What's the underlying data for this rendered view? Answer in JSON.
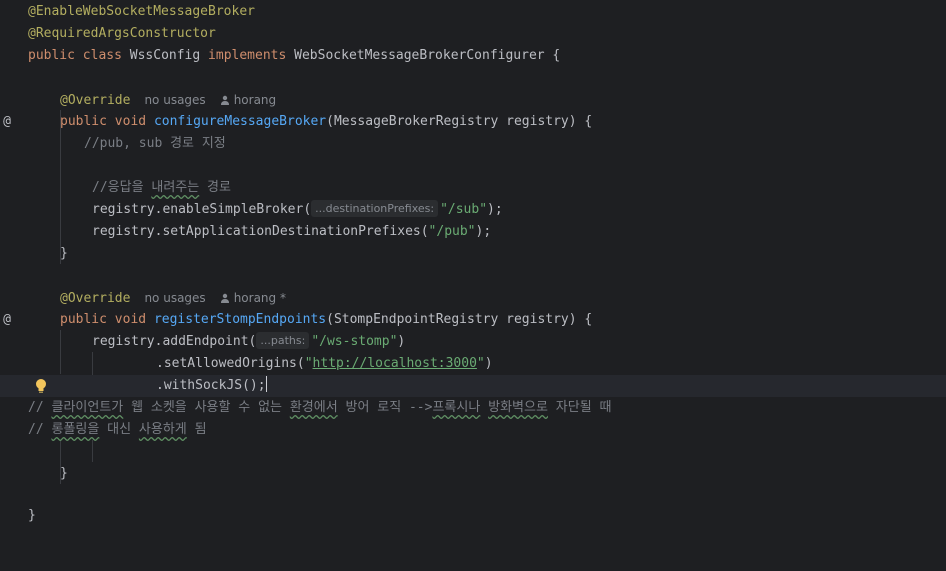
{
  "code": {
    "l1": "@EnableWebSocketMessageBroker",
    "l2": "@RequiredArgsConstructor",
    "l3_kw1": "public",
    "l3_kw2": "class",
    "l3_name": "WssConfig",
    "l3_kw3": "implements",
    "l3_iface": "WebSocketMessageBrokerConfigurer {",
    "m1_annotation": "@Override",
    "m1_usages": "no usages",
    "m1_author": "horang",
    "m1_kw1": "public",
    "m1_kw2": "void",
    "m1_name": "configureMessageBroker",
    "m1_params": "(MessageBrokerRegistry registry) {",
    "m1_comment1": "//pub, sub 경로 지정",
    "m1_comment2_a": "//응답을 ",
    "m1_comment2_b": "내려주는",
    "m1_comment2_c": " 경로",
    "m1_call1": "registry.enableSimpleBroker(",
    "m1_hint1": "...destinationPrefixes:",
    "m1_str1": "\"/sub\"",
    "m1_end1": ");",
    "m1_call2": "registry.setApplicationDestinationPrefixes(",
    "m1_str2": "\"/pub\"",
    "m1_end2": ");",
    "close_brace": "}",
    "m2_annotation": "@Override",
    "m2_usages": "no usages",
    "m2_author": "horang *",
    "m2_kw1": "public",
    "m2_kw2": "void",
    "m2_name": "registerStompEndpoints",
    "m2_params": "(StompEndpointRegistry registry) {",
    "m2_call1": "registry.addEndpoint(",
    "m2_hint1": "...paths:",
    "m2_str1": "\"/ws-stomp\"",
    "m2_end1": ")",
    "m2_call2": ".setAllowedOrigins(",
    "m2_str2_q1": "\"",
    "m2_url": "http://localhost:3000",
    "m2_str2_q2": "\"",
    "m2_end2": ")",
    "m2_call3": ".withSockJS();",
    "c1_a": "// ",
    "c1_b": "클라이언트가",
    "c1_c": " 웹 소켓을 사용할 수 없는 ",
    "c1_d": "환경에서",
    "c1_e": " 방어 로직 -->",
    "c1_f": "프록시나",
    "c1_g": " ",
    "c1_h": "방화벽으로",
    "c1_i": " 자단될 때",
    "c2_a": "// ",
    "c2_b": "롱폴링을",
    "c2_c": " 대신 ",
    "c2_d": "사용하게",
    "c2_e": " 됨",
    "m2_close": "}",
    "class_close": "}"
  },
  "gutter": {
    "implements_marker": "@"
  },
  "colors": {
    "background": "#1e1f22",
    "annotation": "#b3ae60",
    "keyword": "#cf8e6d",
    "function": "#56a8f5",
    "string": "#6aab73",
    "comment": "#7a7e85",
    "text": "#bcbec4"
  }
}
